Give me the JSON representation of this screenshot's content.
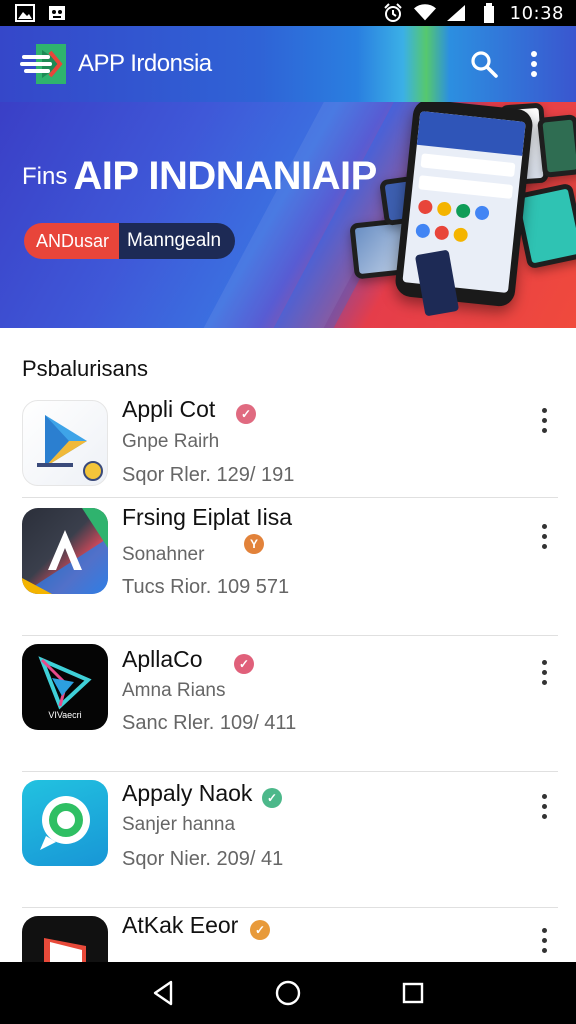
{
  "status_bar": {
    "left_icons": [
      "image-icon",
      "android-icon"
    ],
    "right_icons": [
      "alarm-icon",
      "wifi-icon",
      "signal-icon",
      "battery-icon"
    ],
    "time": "10:38"
  },
  "app_bar": {
    "title": "APP Irdonsia",
    "actions": [
      "search-icon",
      "more-vert-icon"
    ]
  },
  "banner": {
    "prefix": "Fins",
    "headline": "AIP INDNANIAIP",
    "pill_primary": "ANDusar",
    "pill_secondary": "Manngealn",
    "accent_color": "#e8453a"
  },
  "section": {
    "title": "Psbalurisans"
  },
  "apps": [
    {
      "name": "Appli Cot",
      "developer": "Gnpe Rairh",
      "meta": "Sqor Rler. 129/ 191",
      "badge_color": "#e06a80",
      "badge_glyph": "✓"
    },
    {
      "name": "Frsing Eiplat Iisa",
      "developer": "Sonahner",
      "meta": "Tucs Rior. 109 571",
      "badge_color": "#e2823a",
      "badge_glyph": "Y"
    },
    {
      "name": "ApllaCo",
      "developer": "Amna Rians",
      "meta": "Sanc Rler. 109/ 411",
      "badge_color": "#e0607a",
      "badge_glyph": "✓"
    },
    {
      "name": "Appaly Naok",
      "developer": "Sanjer hanna",
      "meta": "Sqor Nier. 209/ 41",
      "badge_color": "#4cb88a",
      "badge_glyph": "✓"
    },
    {
      "name": "AtKak Eeor",
      "developer": "",
      "meta": "",
      "badge_color": "#e89a3a",
      "badge_glyph": "✓"
    }
  ],
  "nav_bar": {
    "buttons": [
      "back-icon",
      "home-icon",
      "recents-icon"
    ]
  }
}
